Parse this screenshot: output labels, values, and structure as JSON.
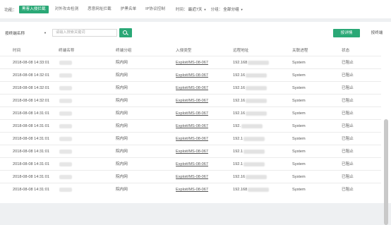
{
  "topbar": {
    "label": "功能：",
    "tabs": [
      {
        "label": "黑客入侵拦截",
        "active": true
      },
      {
        "label": "对外攻击检测",
        "active": false
      },
      {
        "label": "恶意网址拦截",
        "active": false
      },
      {
        "label": "护黑名单",
        "active": false
      },
      {
        "label": "IP协议控制",
        "active": false
      }
    ],
    "time_label": "时间：",
    "time_value": "最近7天",
    "group_label": "分组：",
    "group_value": "全部分组"
  },
  "toolbar": {
    "select_value": "按终端名称",
    "search_placeholder": "请输入搜索关键词",
    "button_primary": "按详情",
    "button_secondary": "按终端"
  },
  "table": {
    "headers": [
      "时间",
      "终端名称",
      "终端分组",
      "入侵类型",
      "远程地址",
      "关联进程",
      "状态"
    ],
    "rows": [
      {
        "time": "2018-08-08 14:33:01",
        "name": "",
        "group": "院内网",
        "type": "Exploit/MS-08-067",
        "ip": "192.168",
        "process": "System",
        "status": "已阻止"
      },
      {
        "time": "2018-08-08 14:32:01",
        "name": "",
        "group": "院内网",
        "type": "Exploit/MS-08-067",
        "ip": "192.16",
        "process": "System",
        "status": "已阻止"
      },
      {
        "time": "2018-08-08 14:32:01",
        "name": "",
        "group": "院内网",
        "type": "Exploit/MS-08-067",
        "ip": "192.16",
        "process": "System",
        "status": "已阻止"
      },
      {
        "time": "2018-08-08 14:32:01",
        "name": "",
        "group": "院内网",
        "type": "Exploit/MS-08-067",
        "ip": "192.16",
        "process": "System",
        "status": "已阻止"
      },
      {
        "time": "2018-08-08 14:31:01",
        "name": "",
        "group": "院内网",
        "type": "Exploit/MS-08-067",
        "ip": "192.16",
        "process": "System",
        "status": "已阻止"
      },
      {
        "time": "2018-08-08 14:31:01",
        "name": "",
        "group": "院内网",
        "type": "Exploit/MS-08-067",
        "ip": "192.",
        "process": "System",
        "status": "已阻止"
      },
      {
        "time": "2018-08-08 14:31:01",
        "name": "",
        "group": "院内网",
        "type": "Exploit/MS-08-067",
        "ip": "192.1",
        "process": "System",
        "status": "已阻止"
      },
      {
        "time": "2018-08-08 14:31:01",
        "name": "",
        "group": "院内网",
        "type": "Exploit/MS-08-067",
        "ip": "192.1",
        "process": "System",
        "status": "已阻止"
      },
      {
        "time": "2018-08-08 14:31:01",
        "name": "",
        "group": "院内网",
        "type": "Exploit/MS-08-067",
        "ip": "192.1",
        "process": "System",
        "status": "已阻止"
      },
      {
        "time": "2018-08-08 14:31:01",
        "name": "",
        "group": "院内网",
        "type": "Exploit/MS-08-067",
        "ip": "192.16",
        "process": "System",
        "status": "已阻止"
      },
      {
        "time": "2018-08-08 14:31:01",
        "name": "",
        "group": "院内网",
        "type": "Exploit/MS-08-067",
        "ip": "192.168",
        "process": "System",
        "status": "已阻止"
      }
    ]
  },
  "colors": {
    "accent": "#2aa876"
  },
  "icons": {
    "search_button": "search-icon",
    "dropdown": "caret-down-icon"
  }
}
